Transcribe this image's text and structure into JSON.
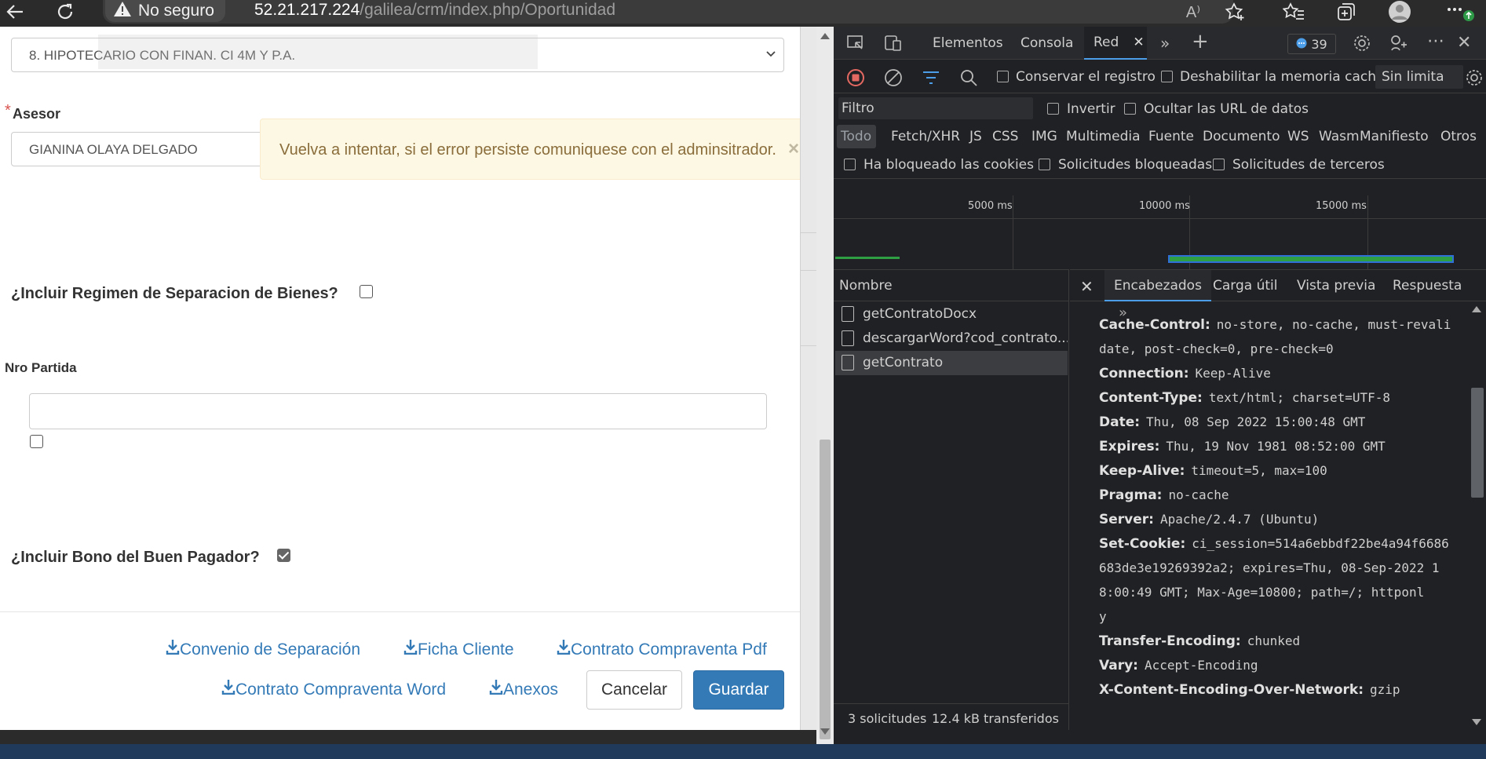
{
  "browser": {
    "not_secure_label": "No seguro",
    "url_host": "52.21.217.224",
    "url_path": "/galilea/crm/index.php/Oportunidad",
    "read_aloud_label": "A⁾"
  },
  "form": {
    "credit_type_value": "8. HIPOTECARIO CON FINAN. CI 4M Y P.A.",
    "advisor_required_mark": "*",
    "advisor_label": "Asesor",
    "advisor_value": "GIANINA OLAYA DELGADO",
    "separation_question": "¿Incluir Regimen de Separacion de Bienes?",
    "partida_label": "Nro Partida",
    "partida_value": "",
    "bono_question": "¿Incluir Bono del Buen Pagador?",
    "separation_checked": false,
    "partida_checked": false,
    "bono_checked": true
  },
  "alert": {
    "message": "Vuelva a intentar, si el error persiste comuniquese con el adminsitrador.",
    "close": "×"
  },
  "actions": {
    "convenio": "Convenio de Separación",
    "ficha": "Ficha Cliente",
    "contrato_pdf": "Contrato Compraventa Pdf",
    "contrato_word": "Contrato Compraventa Word",
    "anexos": "Anexos",
    "cancel": "Cancelar",
    "save": "Guardar"
  },
  "devtools": {
    "tabs": [
      "Elementos",
      "Consola",
      "Red"
    ],
    "issues_count": "39",
    "preserve_log": "Conservar el registro",
    "disable_cache": "Deshabilitar la memoria caché",
    "throttling": "Sin limita",
    "filter_placeholder": "Filtro",
    "invert": "Invertir",
    "hide_data_urls": "Ocultar las URL de datos",
    "types": [
      "Todo",
      "Fetch/XHR",
      "JS",
      "CSS",
      "IMG",
      "Multimedia",
      "Fuente",
      "Documento",
      "WS",
      "Wasm",
      "Manifiesto",
      "Otros"
    ],
    "blocked_cookies": "Ha bloqueado las cookies",
    "blocked_requests": "Solicitudes bloqueadas",
    "third_party": "Solicitudes de terceros",
    "timeline_ticks": [
      "5000 ms",
      "10000 ms",
      "15000 ms"
    ],
    "name_column": "Nombre",
    "requests": [
      "getContratoDocx",
      "descargarWord?cod_contrato...",
      "getContrato"
    ],
    "detail_tabs": [
      "Encabezados",
      "Carga útil",
      "Vista previa",
      "Respuesta"
    ],
    "status_requests": "3 solicitudes",
    "status_transferred": "12.4 kB transferidos",
    "headers": [
      {
        "key": "Cache-Control:",
        "value": "no-store, no-cache, must-revali",
        "cont": [
          "date, post-check=0, pre-check=0"
        ]
      },
      {
        "key": "Connection:",
        "value": "Keep-Alive",
        "cont": []
      },
      {
        "key": "Content-Type:",
        "value": "text/html; charset=UTF-8",
        "cont": []
      },
      {
        "key": "Date:",
        "value": "Thu, 08 Sep 2022 15:00:48 GMT",
        "cont": []
      },
      {
        "key": "Expires:",
        "value": "Thu, 19 Nov 1981 08:52:00 GMT",
        "cont": []
      },
      {
        "key": "Keep-Alive:",
        "value": "timeout=5, max=100",
        "cont": []
      },
      {
        "key": "Pragma:",
        "value": "no-cache",
        "cont": []
      },
      {
        "key": "Server:",
        "value": "Apache/2.4.7 (Ubuntu)",
        "cont": []
      },
      {
        "key": "Set-Cookie:",
        "value": "ci_session=514a6ebbdf22be4a94f6686",
        "cont": [
          "683de3e19269392a2; expires=Thu, 08-Sep-2022 1",
          "8:00:49 GMT; Max-Age=10800; path=/; httponl",
          "y"
        ]
      },
      {
        "key": "Transfer-Encoding:",
        "value": "chunked",
        "cont": []
      },
      {
        "key": "Vary:",
        "value": "Accept-Encoding",
        "cont": []
      },
      {
        "key": "X-Content-Encoding-Over-Network:",
        "value": "gzip",
        "cont": []
      }
    ]
  }
}
